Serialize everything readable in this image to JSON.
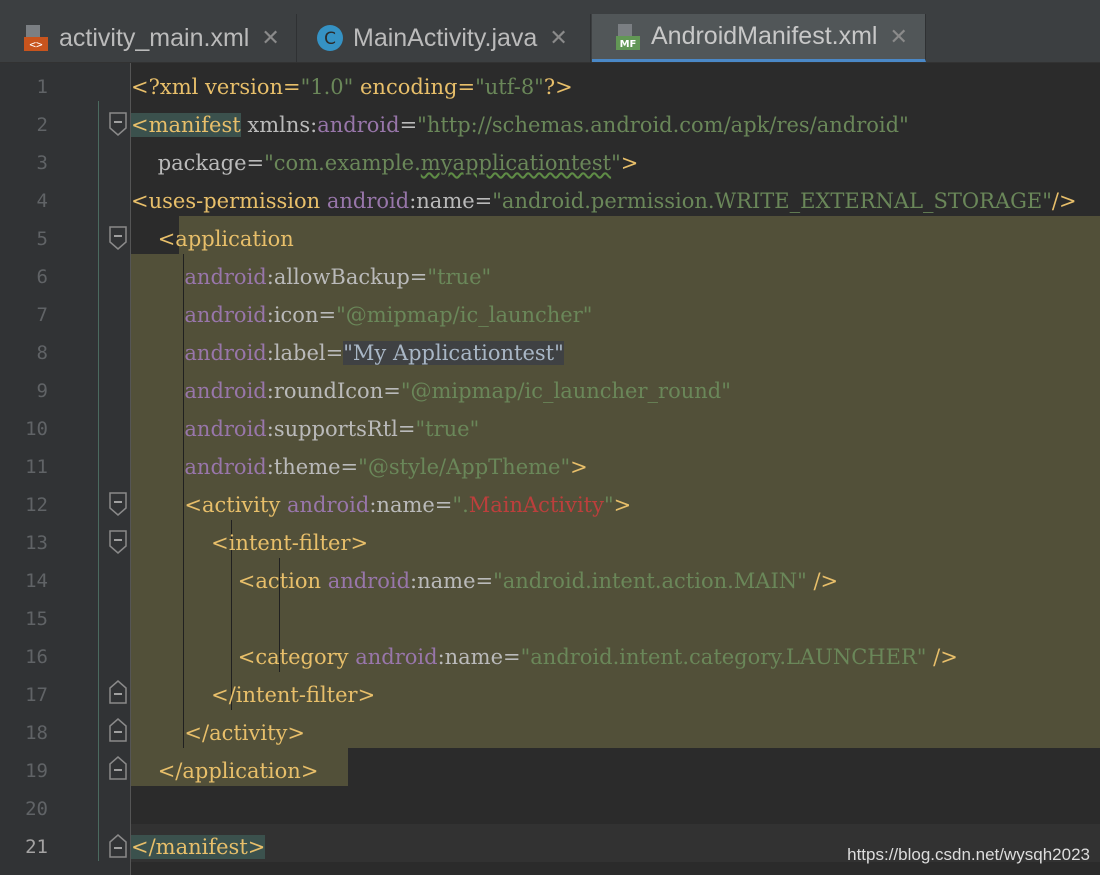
{
  "tabs": [
    {
      "label": "activity_main.xml",
      "icon": "xml-layout-icon",
      "close": "✕",
      "active": false
    },
    {
      "label": "MainActivity.java",
      "icon": "java-class-icon",
      "close": "✕",
      "active": false
    },
    {
      "label": "AndroidManifest.xml",
      "icon": "manifest-file-icon",
      "close": "✕",
      "active": true
    }
  ],
  "line_numbers": [
    "1",
    "2",
    "3",
    "4",
    "5",
    "6",
    "7",
    "8",
    "9",
    "10",
    "11",
    "12",
    "13",
    "14",
    "15",
    "16",
    "17",
    "18",
    "19",
    "20",
    "21"
  ],
  "code": {
    "l1": {
      "a": "<?xml version=",
      "b": "\"1.0\"",
      "c": " encoding=",
      "d": "\"utf-8\"",
      "e": "?>"
    },
    "l2": {
      "a": "<manifest",
      "b": " xmlns:",
      "c": "android",
      "d": "=",
      "e": "\"http://schemas.android.com/apk/res/android\""
    },
    "l3": {
      "a": "    package=",
      "b": "\"com.example.",
      "c": "myapplicationtest",
      "d": "\"",
      "e": ">"
    },
    "l4": {
      "a": "<uses-permission ",
      "b": "android",
      "c": ":name=",
      "d": "\"android.permission.WRITE_EXTERNAL_STORAGE\"",
      "e": "/>"
    },
    "l5": {
      "a": "    ",
      "b": "<application"
    },
    "l6": {
      "a": "        ",
      "b": "android",
      "c": ":allowBackup=",
      "d": "\"true\""
    },
    "l7": {
      "a": "        ",
      "b": "android",
      "c": ":icon=",
      "d": "\"@mipmap/ic_launcher\""
    },
    "l8": {
      "a": "        ",
      "b": "android",
      "c": ":label=",
      "d": "\"My Applicationtest\""
    },
    "l9": {
      "a": "        ",
      "b": "android",
      "c": ":roundIcon=",
      "d": "\"@mipmap/ic_launcher_round\""
    },
    "l10": {
      "a": "        ",
      "b": "android",
      "c": ":supportsRtl=",
      "d": "\"true\""
    },
    "l11": {
      "a": "        ",
      "b": "android",
      "c": ":theme=",
      "d": "\"@style/AppTheme\"",
      "e": ">"
    },
    "l12": {
      "a": "        <activity ",
      "b": "android",
      "c": ":name=",
      "d": "\".",
      "e": "MainActivity",
      "f": "\"",
      "g": ">"
    },
    "l13": {
      "a": "            <intent-filter>"
    },
    "l14": {
      "a": "                <action ",
      "b": "android",
      "c": ":name=",
      "d": "\"android.intent.action.MAIN\"",
      "e": " />"
    },
    "l16": {
      "a": "                <category ",
      "b": "android",
      "c": ":name=",
      "d": "\"android.intent.category.LAUNCHER\"",
      "e": " />"
    },
    "l17": {
      "a": "            </intent-filter>"
    },
    "l18": {
      "a": "        </activity>"
    },
    "l19": {
      "a": "    ",
      "b": "</application>"
    },
    "l21": {
      "a": "</manifest>"
    }
  },
  "watermark": "https://blog.csdn.net/wysqh2023",
  "colors": {
    "tag": "#e8bf6a",
    "namespace": "#9876aa",
    "string": "#6a8759",
    "selection": "#525039",
    "background": "#2b2b2b"
  }
}
